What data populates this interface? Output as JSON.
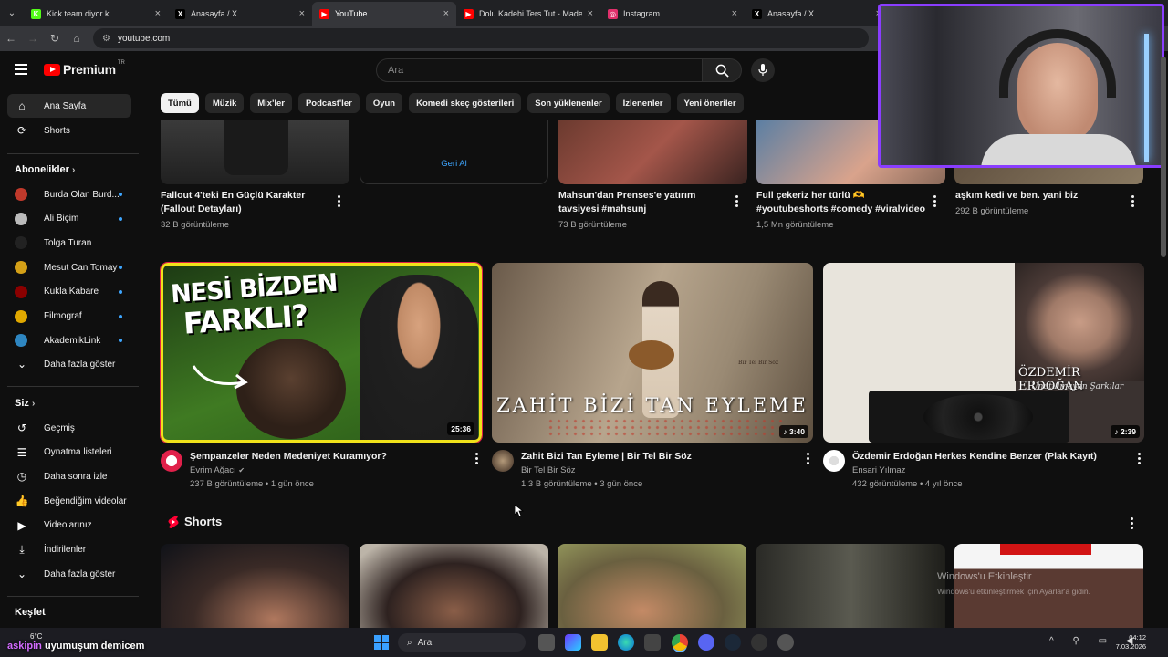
{
  "browser": {
    "tabs": [
      {
        "title": "Kick team diyor ki...",
        "fav_color": "#53fc18",
        "fav_glyph": "K"
      },
      {
        "title": "Anasayfa / X",
        "fav_color": "#000000",
        "fav_glyph": "X"
      },
      {
        "title": "YouTube",
        "fav_color": "#ff0000",
        "fav_glyph": "▶",
        "active": true
      },
      {
        "title": "Dolu Kadehi Ters Tut - Madem",
        "fav_color": "#ff0000",
        "fav_glyph": "▶"
      },
      {
        "title": "Instagram",
        "fav_color": "#e1306c",
        "fav_glyph": "◎"
      },
      {
        "title": "Anasayfa / X",
        "fav_color": "#000000",
        "fav_glyph": "X"
      }
    ],
    "url": "youtube.com"
  },
  "youtube": {
    "logo_text": "Premium",
    "logo_region": "TR",
    "search_placeholder": "Ara",
    "sidebar": {
      "main": [
        {
          "label": "Ana Sayfa",
          "icon": "home-icon",
          "active": true
        },
        {
          "label": "Shorts",
          "icon": "shorts-icon"
        }
      ],
      "subscriptions_heading": "Abonelikler",
      "subscriptions": [
        {
          "label": "Burda Olan Burd...",
          "color": "#c0392b"
        },
        {
          "label": "Ali Biçim",
          "color": "#bbbbbb"
        },
        {
          "label": "Tolga Turan",
          "color": "#222222"
        },
        {
          "label": "Mesut Can Tomay",
          "color": "#d4a017"
        },
        {
          "label": "Kukla Kabare",
          "color": "#8b0000"
        },
        {
          "label": "Filmograf",
          "color": "#e0a800"
        },
        {
          "label": "AkademikLink",
          "color": "#2e86c1"
        }
      ],
      "show_more": "Daha fazla göster",
      "you_heading": "Siz",
      "you_items": [
        {
          "label": "Geçmiş",
          "icon": "history-icon"
        },
        {
          "label": "Oynatma listeleri",
          "icon": "playlist-icon"
        },
        {
          "label": "Daha sonra izle",
          "icon": "clock-icon"
        },
        {
          "label": "Beğendiğim videolar",
          "icon": "thumbs-up-icon"
        },
        {
          "label": "Videolarınız",
          "icon": "video-icon"
        },
        {
          "label": "İndirilenler",
          "icon": "download-icon"
        },
        {
          "label": "Daha fazla göster",
          "icon": "chevron-down-icon"
        }
      ],
      "explore_heading": "Keşfet"
    },
    "chips": [
      "Tümü",
      "Müzik",
      "Mix'ler",
      "Podcast'ler",
      "Oyun",
      "Komedi skeç gösterileri",
      "Son yüklenenler",
      "İzlenenler",
      "Yeni öneriler"
    ],
    "top_row": [
      {
        "title": "Fallout 4'teki En Güçlü Karakter (Fallout Detayları)",
        "views": "32 B görüntüleme"
      },
      {
        "undo": "Geri Al"
      },
      {
        "title": "Mahsun'dan Prenses'e yatırım tavsiyesi #mahsunj",
        "views": "73 B görüntüleme"
      },
      {
        "title": "Full çekeriz her türlü 🫶 #youtubeshorts #comedy #viralvideo",
        "views": "1,5 Mn görüntüleme"
      },
      {
        "title": "aşkım kedi ve ben. yani biz",
        "views": "292 B görüntüleme"
      }
    ],
    "videos": [
      {
        "title": "Şempanzeler Neden Medeniyet Kuramıyor?",
        "channel": "Evrim Ağacı",
        "verified": "✔",
        "meta": "237 B görüntüleme • 1 gün önce",
        "duration": "25:36",
        "thumb_text_1": "NESİ BİZDEN",
        "thumb_text_2": "FARKLI?"
      },
      {
        "title": "Zahit Bizi Tan Eyleme | Bir Tel Bir Söz",
        "channel": "Bir Tel Bir Söz",
        "meta": "1,3 B görüntüleme • 3 gün önce",
        "duration": "♪ 3:40",
        "thumb_text": "ZAHİT BİZİ TAN EYLEME",
        "thumb_small": "Bir Tel Bir Söz"
      },
      {
        "title": "Özdemir Erdoğan Herkes Kendine Benzer (Plak Kayıt)",
        "channel": "Ensari Yılmaz",
        "meta": "432 görüntüleme • 4 yıl önce",
        "duration": "♪ 2:39",
        "thumb_text": "ÖZDEMİR ERDOĞAN",
        "thumb_small": "Unutulmayan Şarkılar"
      }
    ],
    "shorts_heading": "Shorts"
  },
  "overlay": {
    "windows_activate": "Windows'u Etkinleştir",
    "windows_activate_sub": "Windows'u etkinleştirmek için Ayarlar'a gidin.",
    "stream_user": "askipin",
    "stream_text": "uyumuşum demicem",
    "weather": "6°C"
  },
  "taskbar": {
    "search": "Ara",
    "time": "04:12",
    "date": "7.03.2026"
  }
}
